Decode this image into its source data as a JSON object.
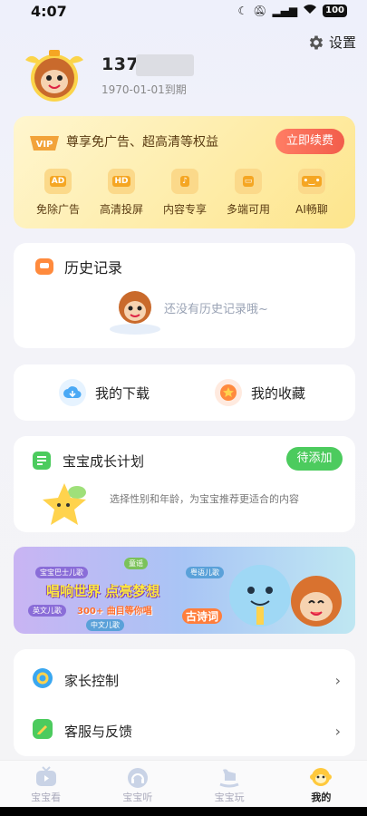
{
  "status_bar": {
    "time": "4:07",
    "battery": "100"
  },
  "header": {
    "settings_label": "设置"
  },
  "profile": {
    "phone_prefix": "1371",
    "expire": "1970-01-01到期"
  },
  "vip": {
    "badge": "VIP",
    "promo": "尊享免广告、超高清等权益",
    "renew_label": "立即续费",
    "perks": [
      {
        "icon": "ad-icon",
        "glyph": "AD",
        "label": "免除广告"
      },
      {
        "icon": "hd-icon",
        "glyph": "HD",
        "label": "高清投屏"
      },
      {
        "icon": "exclusive-content-icon",
        "glyph": "♪",
        "label": "内容专享"
      },
      {
        "icon": "multi-device-icon",
        "glyph": "▭",
        "label": "多端可用"
      },
      {
        "icon": "ai-chat-icon",
        "glyph": "•‿•",
        "label": "AI畅聊"
      }
    ]
  },
  "history": {
    "title": "历史记录",
    "empty_text": "还没有历史记录哦~"
  },
  "shortcuts": {
    "downloads": "我的下载",
    "favorites": "我的收藏"
  },
  "growth": {
    "title": "宝宝成长计划",
    "pending_label": "待添加",
    "description": "选择性别和年龄，为宝宝推荐更适合的内容"
  },
  "banner": {
    "brand": "宝宝巴士儿歌",
    "headline": "唱响世界 点亮梦想",
    "sub": "300+ 曲目等你唱",
    "tags": [
      "童谣",
      "粤语儿歌",
      "英文儿歌",
      "中文儿歌"
    ],
    "poem": "古诗词"
  },
  "menu": {
    "parental_control": "家长控制",
    "feedback": "客服与反馈"
  },
  "tabs": [
    {
      "label": "宝宝看",
      "icon": "tv-icon"
    },
    {
      "label": "宝宝听",
      "icon": "headphones-icon"
    },
    {
      "label": "宝宝玩",
      "icon": "rocking-horse-icon"
    },
    {
      "label": "我的",
      "icon": "monkey-face-icon"
    }
  ],
  "colors": {
    "accent_red": "#f25d4b",
    "accent_green": "#4ccb5e",
    "vip_gold": "#fde58c"
  }
}
